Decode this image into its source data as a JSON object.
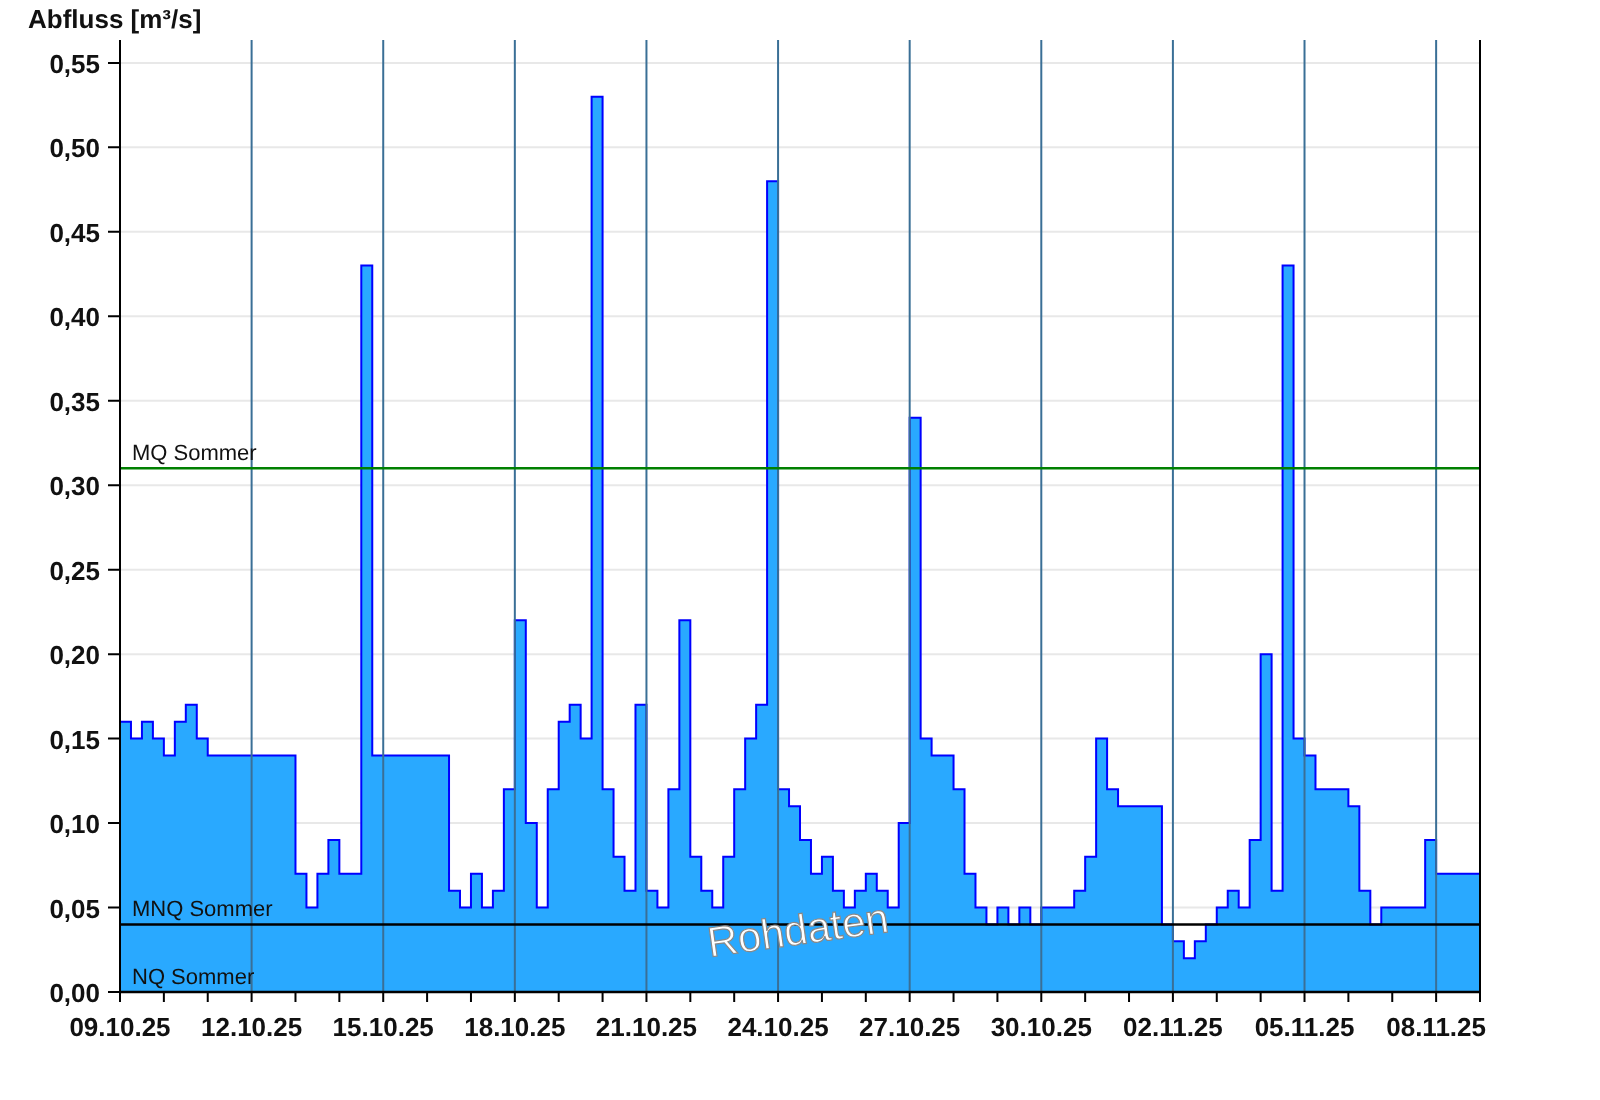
{
  "chart": {
    "chart_data": {
      "type": "area",
      "ylabel": "Abfluss [m³/s]",
      "categories": [
        "09.10.25",
        null,
        null,
        null,
        null,
        null,
        null,
        null,
        null,
        null,
        null,
        null,
        "12.10.25",
        null,
        null,
        null,
        null,
        null,
        null,
        null,
        null,
        null,
        null,
        null,
        "15.10.25",
        null,
        null,
        null,
        null,
        null,
        null,
        null,
        null,
        null,
        null,
        null,
        "18.10.25",
        null,
        null,
        null,
        null,
        null,
        null,
        null,
        null,
        null,
        null,
        null,
        "21.10.25",
        null,
        null,
        null,
        null,
        null,
        null,
        null,
        null,
        null,
        null,
        null,
        "24.10.25",
        null,
        null,
        null,
        null,
        null,
        null,
        null,
        null,
        null,
        null,
        null,
        "27.10.25",
        null,
        null,
        null,
        null,
        null,
        null,
        null,
        null,
        null,
        null,
        null,
        "30.10.25",
        null,
        null,
        null,
        null,
        null,
        null,
        null,
        null,
        null,
        null,
        null,
        "02.11.25",
        null,
        null,
        null,
        null,
        null,
        null,
        null,
        null,
        null,
        null,
        null,
        "05.11.25",
        null,
        null,
        null,
        null,
        null,
        null,
        null,
        null,
        null,
        null,
        null,
        "08.11.25",
        null,
        null,
        null,
        null
      ],
      "series": [
        {
          "color": "#0000ff",
          "values": [
            0.16,
            0.15,
            0.16,
            0.15,
            0.14,
            0.16,
            0.17,
            0.15,
            0.14,
            0.14,
            0.14,
            0.14,
            0.14,
            0.14,
            0.14,
            0.14,
            0.07,
            0.05,
            0.07,
            0.09,
            0.07,
            0.07,
            0.43,
            0.14,
            0.14,
            0.14,
            0.14,
            0.14,
            0.14,
            0.14,
            0.06,
            0.05,
            0.07,
            0.05,
            0.06,
            0.12,
            0.22,
            0.1,
            0.05,
            0.12,
            0.16,
            0.17,
            0.15,
            0.53,
            0.12,
            0.08,
            0.06,
            0.17,
            0.06,
            0.05,
            0.12,
            0.22,
            0.08,
            0.06,
            0.05,
            0.08,
            0.12,
            0.15,
            0.17,
            0.48,
            0.12,
            0.11,
            0.09,
            0.07,
            0.08,
            0.06,
            0.05,
            0.06,
            0.07,
            0.06,
            0.05,
            0.1,
            0.34,
            0.15,
            0.14,
            0.14,
            0.12,
            0.07,
            0.05,
            0.04,
            0.05,
            0.04,
            0.05,
            0.04,
            0.05,
            0.05,
            0.05,
            0.06,
            0.08,
            0.15,
            0.12,
            0.11,
            0.11,
            0.11,
            0.11,
            0.04,
            0.03,
            0.02,
            0.03,
            0.04,
            0.05,
            0.06,
            0.05,
            0.09,
            0.2,
            0.06,
            0.43,
            0.15,
            0.14,
            0.12,
            0.12,
            0.12,
            0.11,
            0.06,
            0.04,
            0.05,
            0.05,
            0.05,
            0.05,
            0.09,
            0.07,
            0.07,
            0.07,
            0.07,
            0.07
          ]
        },
        {
          "name": "MQ Sommer",
          "type": "line",
          "color": "#008000",
          "values": [
            0.31,
            0.31,
            0.31,
            0.31,
            0.31,
            0.31,
            0.31,
            0.31,
            0.31,
            0.31,
            0.31,
            0.31,
            0.31,
            0.31,
            0.31,
            0.31,
            0.31,
            0.31,
            0.31,
            0.31,
            0.31,
            0.31,
            0.31,
            0.31,
            0.31,
            0.31,
            0.31,
            0.31,
            0.31,
            0.31,
            0.31,
            0.31,
            0.31,
            0.31,
            0.31,
            0.31,
            0.31,
            0.31,
            0.31,
            0.31,
            0.31,
            0.31,
            0.31,
            0.31,
            0.31,
            0.31,
            0.31,
            0.31,
            0.31,
            0.31,
            0.31,
            0.31,
            0.31,
            0.31,
            0.31,
            0.31,
            0.31,
            0.31,
            0.31,
            0.31,
            0.31,
            0.31,
            0.31,
            0.31,
            0.31,
            0.31,
            0.31,
            0.31,
            0.31,
            0.31,
            0.31,
            0.31,
            0.31,
            0.31,
            0.31,
            0.31,
            0.31,
            0.31,
            0.31,
            0.31,
            0.31,
            0.31,
            0.31,
            0.31,
            0.31,
            0.31,
            0.31,
            0.31,
            0.31,
            0.31,
            0.31,
            0.31,
            0.31,
            0.31,
            0.31,
            0.31,
            0.31,
            0.31,
            0.31,
            0.31,
            0.31,
            0.31,
            0.31,
            0.31,
            0.31,
            0.31,
            0.31,
            0.31,
            0.31,
            0.31,
            0.31,
            0.31,
            0.31,
            0.31,
            0.31,
            0.31,
            0.31,
            0.31,
            0.31,
            0.31,
            0.31,
            0.31,
            0.31,
            0.31,
            0.31
          ]
        },
        {
          "name": "MNQ Sommer",
          "type": "line",
          "color": "#000000",
          "values": [
            0.04,
            0.04,
            0.04,
            0.04,
            0.04,
            0.04,
            0.04,
            0.04,
            0.04,
            0.04,
            0.04,
            0.04,
            0.04,
            0.04,
            0.04,
            0.04,
            0.04,
            0.04,
            0.04,
            0.04,
            0.04,
            0.04,
            0.04,
            0.04,
            0.04,
            0.04,
            0.04,
            0.04,
            0.04,
            0.04,
            0.04,
            0.04,
            0.04,
            0.04,
            0.04,
            0.04,
            0.04,
            0.04,
            0.04,
            0.04,
            0.04,
            0.04,
            0.04,
            0.04,
            0.04,
            0.04,
            0.04,
            0.04,
            0.04,
            0.04,
            0.04,
            0.04,
            0.04,
            0.04,
            0.04,
            0.04,
            0.04,
            0.04,
            0.04,
            0.04,
            0.04,
            0.04,
            0.04,
            0.04,
            0.04,
            0.04,
            0.04,
            0.04,
            0.04,
            0.04,
            0.04,
            0.04,
            0.04,
            0.04,
            0.04,
            0.04,
            0.04,
            0.04,
            0.04,
            0.04,
            0.04,
            0.04,
            0.04,
            0.04,
            0.04,
            0.04,
            0.04,
            0.04,
            0.04,
            0.04,
            0.04,
            0.04,
            0.04,
            0.04,
            0.04,
            0.04,
            0.04,
            0.04,
            0.04,
            0.04,
            0.04,
            0.04,
            0.04,
            0.04,
            0.04,
            0.04,
            0.04,
            0.04,
            0.04,
            0.04,
            0.04,
            0.04,
            0.04,
            0.04,
            0.04,
            0.04,
            0.04,
            0.04,
            0.04,
            0.04,
            0.04,
            0.04,
            0.04,
            0.04,
            0.04
          ]
        },
        {
          "name": "NQ Sommer",
          "type": "line",
          "color": "#000000",
          "values": [
            0,
            0,
            0,
            0,
            0,
            0,
            0,
            0,
            0,
            0,
            0,
            0,
            0,
            0,
            0,
            0,
            0,
            0,
            0,
            0,
            0,
            0,
            0,
            0,
            0,
            0,
            0,
            0,
            0,
            0,
            0,
            0,
            0,
            0,
            0,
            0,
            0,
            0,
            0,
            0,
            0,
            0,
            0,
            0,
            0,
            0,
            0,
            0,
            0,
            0,
            0,
            0,
            0,
            0,
            0,
            0,
            0,
            0,
            0,
            0,
            0,
            0,
            0,
            0,
            0,
            0,
            0,
            0,
            0,
            0,
            0,
            0,
            0,
            0,
            0,
            0,
            0,
            0,
            0,
            0,
            0,
            0,
            0,
            0,
            0,
            0,
            0,
            0,
            0,
            0,
            0,
            0,
            0,
            0,
            0,
            0,
            0,
            0,
            0,
            0,
            0,
            0,
            0,
            0,
            0,
            0,
            0,
            0,
            0,
            0,
            0,
            0,
            0,
            0,
            0,
            0,
            0,
            0,
            0,
            0,
            0,
            0,
            0,
            0,
            0
          ]
        }
      ],
      "ylim": [
        0,
        0.56
      ],
      "yticks": [
        {
          "value": 0,
          "label": "0,00"
        },
        {
          "value": 0.05,
          "label": "0,05"
        },
        {
          "value": 0.1,
          "label": "0,10"
        },
        {
          "value": 0.15,
          "label": "0,15"
        },
        {
          "value": 0.2,
          "label": "0,20"
        },
        {
          "value": 0.25,
          "label": "0,25"
        },
        {
          "value": 0.3,
          "label": "0,30"
        },
        {
          "value": 0.35,
          "label": "0,35"
        },
        {
          "value": 0.4,
          "label": "0,40"
        },
        {
          "value": 0.45,
          "label": "0,45"
        },
        {
          "value": 0.5,
          "label": "0,50"
        },
        {
          "value": 0.55,
          "label": "0,55"
        }
      ],
      "grid": true,
      "legend": "left",
      "annotations": [
        "Rohdaten"
      ]
    }
  }
}
